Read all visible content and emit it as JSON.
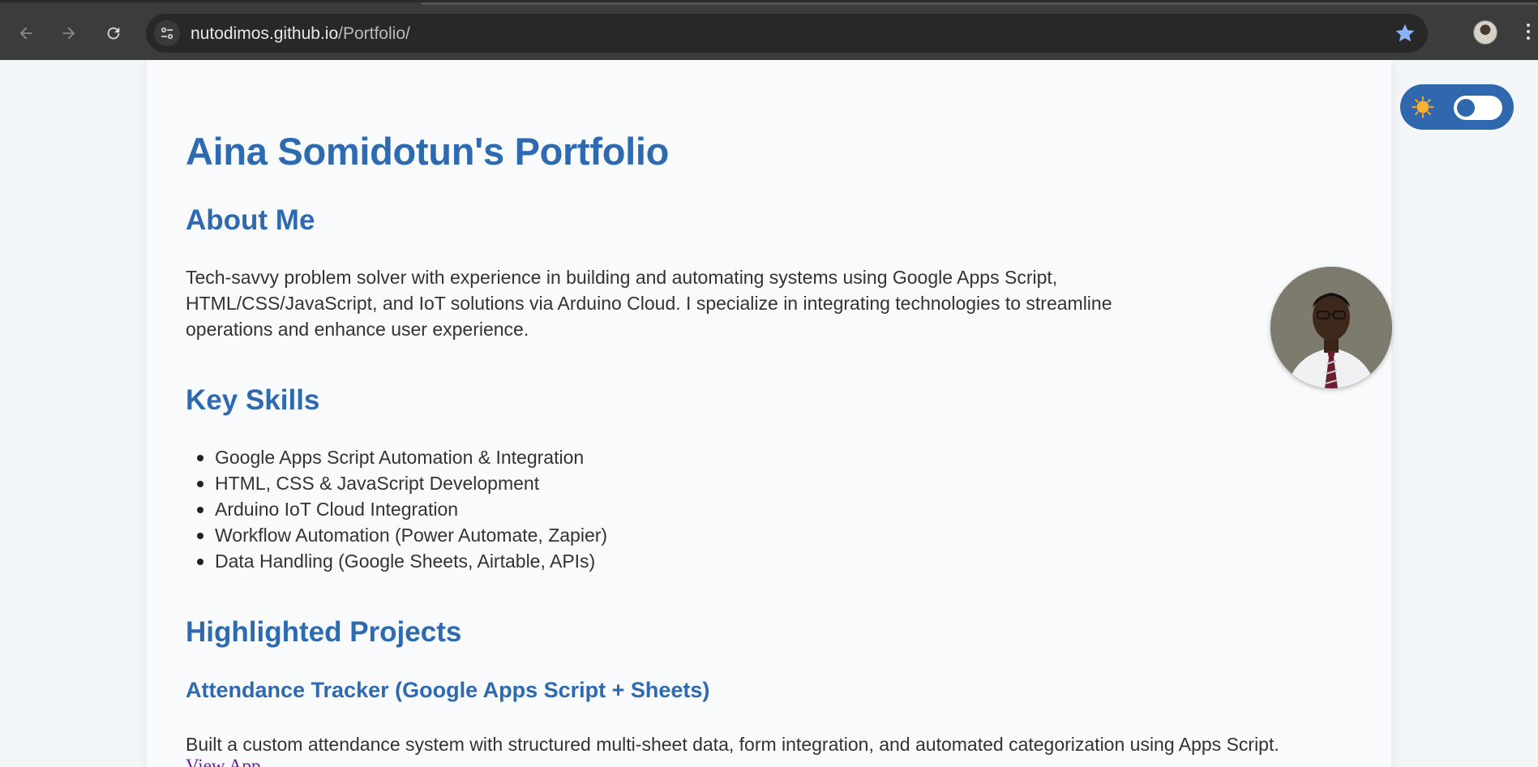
{
  "browser": {
    "url_host": "nutodimos.github.io",
    "url_path": "/Portfolio/",
    "icons": [
      "back-arrow-icon",
      "forward-arrow-icon",
      "reload-icon",
      "site-settings-icon",
      "bookmark-star-icon",
      "profile-avatar-icon",
      "more-menu-icon"
    ]
  },
  "page": {
    "title": "Aina Somidotun's Portfolio",
    "about_heading": "About Me",
    "about_text": "Tech-savvy problem solver with experience in building and automating systems using Google Apps Script, HTML/CSS/JavaScript, and IoT solutions via Arduino Cloud. I specialize in integrating technologies to streamline operations and enhance user experience.",
    "skills_heading": "Key Skills",
    "skills": [
      "Google Apps Script Automation & Integration",
      "HTML, CSS & JavaScript Development",
      "Arduino IoT Cloud Integration",
      "Workflow Automation (Power Automate, Zapier)",
      "Data Handling (Google Sheets, Airtable, APIs)"
    ],
    "projects_heading": "Highlighted Projects",
    "projects": [
      {
        "title": "Attendance Tracker (Google Apps Script + Sheets)",
        "description": "Built a custom attendance system with structured multi-sheet data, form integration, and automated categorization using Apps Script.",
        "link_text": "View App"
      }
    ]
  },
  "theme_toggle": {
    "mode": "light",
    "icon": "sun-icon"
  },
  "colors": {
    "accent": "#2e6ab0",
    "toggle_bg": "#2f68ae",
    "chrome_bg": "#3c3c3c",
    "omnibox_bg": "#282828",
    "link_visited": "#6a1b9a"
  }
}
